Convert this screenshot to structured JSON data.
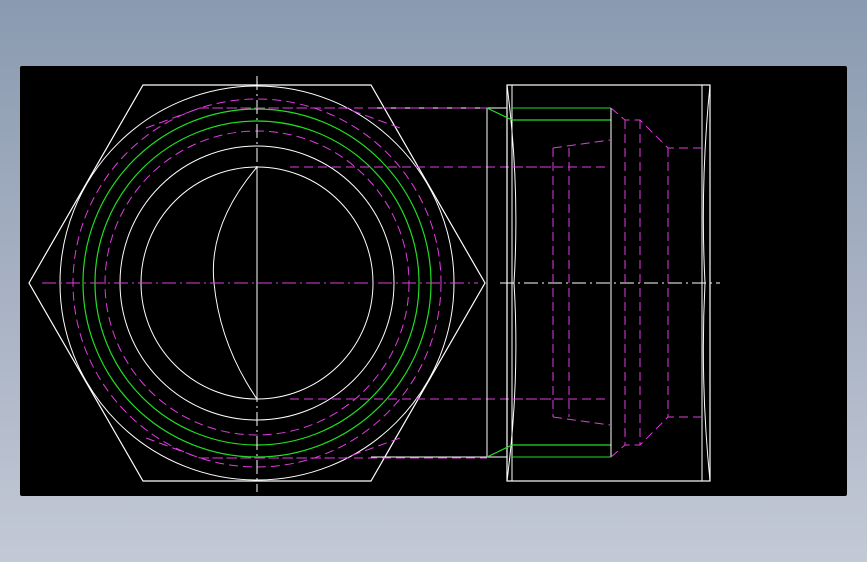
{
  "colors": {
    "background_gradient_top": "#8a9ab0",
    "background_gradient_bottom": "#c3c9d6",
    "canvas": "#000000",
    "outline": "#ffffff",
    "thread": "#22dd22",
    "hidden": "#e03ce0",
    "centerline": "#ffffff"
  },
  "views": [
    {
      "name": "front-view",
      "description_shape": "hexagon-with-bore"
    },
    {
      "name": "side-view",
      "description_shape": "hex-nut-profile"
    }
  ]
}
